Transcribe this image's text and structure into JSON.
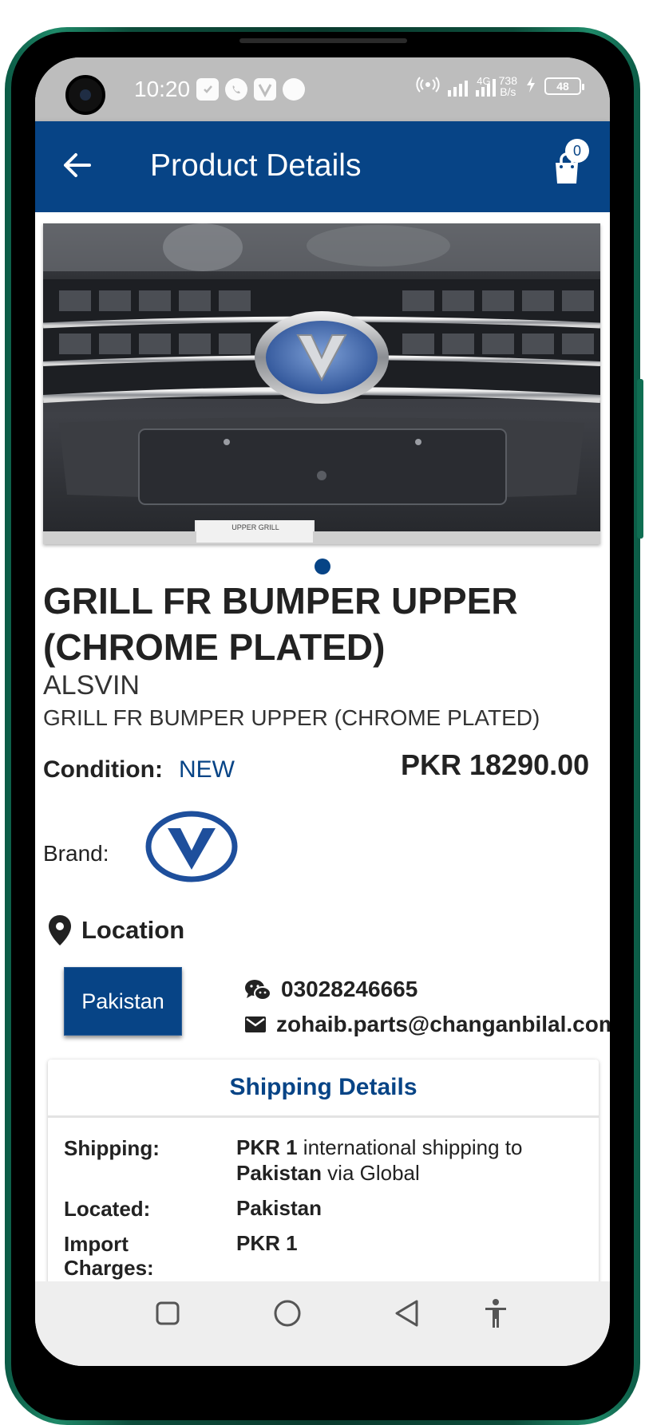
{
  "status_bar": {
    "time": "10:20",
    "network_type": "4G",
    "net_speed_value": "738",
    "net_speed_unit": "B/s",
    "battery": "48",
    "icons": [
      "shield-icon",
      "whatsapp-icon",
      "v-app-icon",
      "sync-icon",
      "hotspot-icon",
      "signal-icon",
      "charging-icon",
      "battery-icon"
    ]
  },
  "app_bar": {
    "title": "Product Details",
    "cart_count": "0"
  },
  "product": {
    "title": "GRILL FR BUMPER UPPER (CHROME PLATED)",
    "model": "ALSVIN",
    "subtitle": "GRILL FR BUMPER UPPER (CHROME PLATED)",
    "condition_label": "Condition:",
    "condition_value": "NEW",
    "price": "PKR 18290.00",
    "brand_label": "Brand:",
    "image_caption": "UPPER GRILL",
    "carousel_count": 1,
    "carousel_active": 1
  },
  "location": {
    "label": "Location",
    "country_button": "Pakistan",
    "phone": "03028246665",
    "email": "zohaib.parts@changanbilal.com"
  },
  "shipping": {
    "title": "Shipping Details",
    "shipping_label": "Shipping:",
    "shipping_amount": "PKR 1",
    "shipping_text": " international shipping to ",
    "shipping_country": "Pakistan",
    "shipping_via": " via Global",
    "located_label": "Located:",
    "located_value": "Pakistan",
    "import_label": "Import Charges:",
    "import_value": "PKR 1"
  },
  "nav_bar": {
    "buttons": [
      "recents-button",
      "home-button",
      "back-button",
      "accessibility-button"
    ]
  },
  "colors": {
    "primary": "#074486",
    "status_bar": "#bdbdbd",
    "phone_frame": "#0d4d3b"
  }
}
